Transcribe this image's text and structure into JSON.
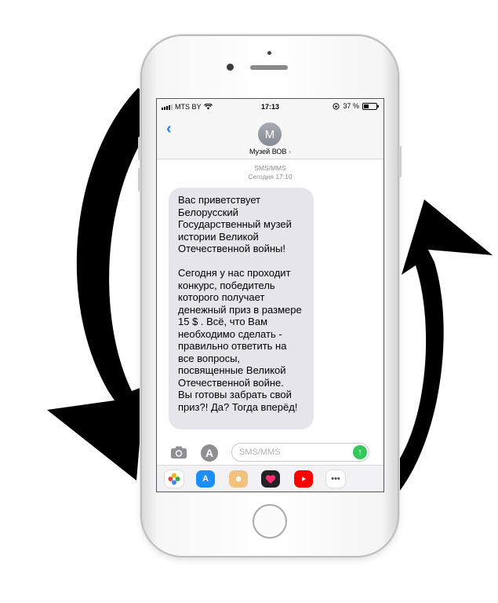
{
  "status_bar": {
    "carrier": "MTS BY",
    "time": "17:13",
    "battery": "37 %",
    "battery_level": 0.37
  },
  "header": {
    "avatar_letter": "М",
    "contact_name": "Музей ВОВ",
    "chevron": "›"
  },
  "thread": {
    "channel": "SMS/MMS",
    "timestamp": "Сегодня 17:10",
    "message": "Вас приветствует Белорусский Государственный музей истории Великой Отечественной войны!\n\nСегодня у нас проходит конкурс, победитель которого получает денежный приз в размере 15 $ . Всё, что Вам необходимо сделать - правильно ответить на все вопросы, посвященные Великой Отечественной войне.\nВы готовы забрать свой приз?! Да? Тогда вперёд!"
  },
  "composer": {
    "placeholder": "SMS/MMS"
  },
  "app_drawer": {
    "apps": [
      "photos-app",
      "app-store-app",
      "memoji-app",
      "digital-touch-app",
      "youtube-app",
      "more-apps"
    ]
  },
  "colors": {
    "accent": "#1f7cf6",
    "bubble": "#e6e6ea",
    "send": "#34c759"
  }
}
